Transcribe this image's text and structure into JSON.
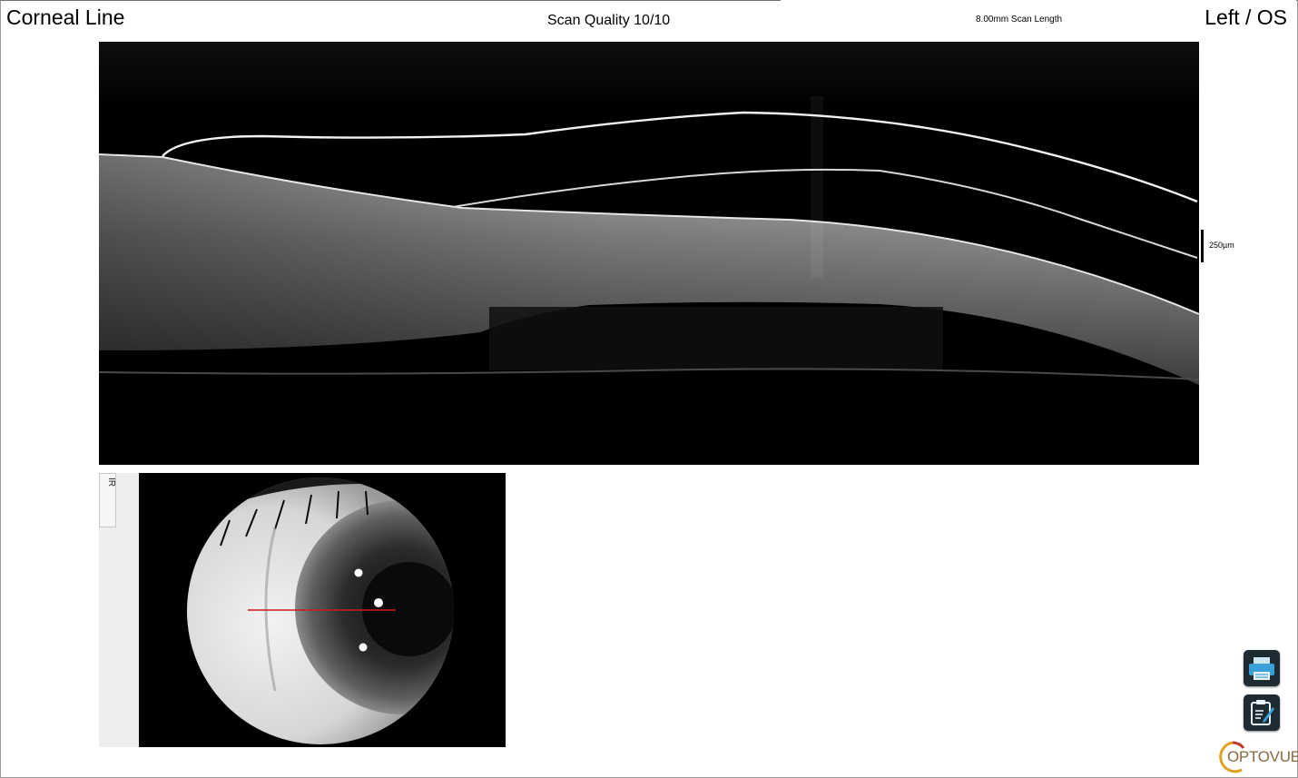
{
  "header": {
    "scan_type": "Corneal Line",
    "scan_quality": "Scan Quality 10/10",
    "scan_length": "8.00mm Scan Length",
    "eye": "Left / OS"
  },
  "oct": {
    "scale_label": "250µm"
  },
  "ir_panel": {
    "tab_label": "IR"
  },
  "toolbar": {
    "print_icon": "printer-icon",
    "report_icon": "clipboard-edit-icon"
  },
  "brand": {
    "logo_text": "OPTOVUE",
    "logo_color": "#8b6a3f",
    "ring_color": "#e0a020"
  },
  "colors": {
    "scan_line": "#d21a1a",
    "button_bg": "#1e2b33",
    "icon_accent": "#3aa0d8"
  }
}
